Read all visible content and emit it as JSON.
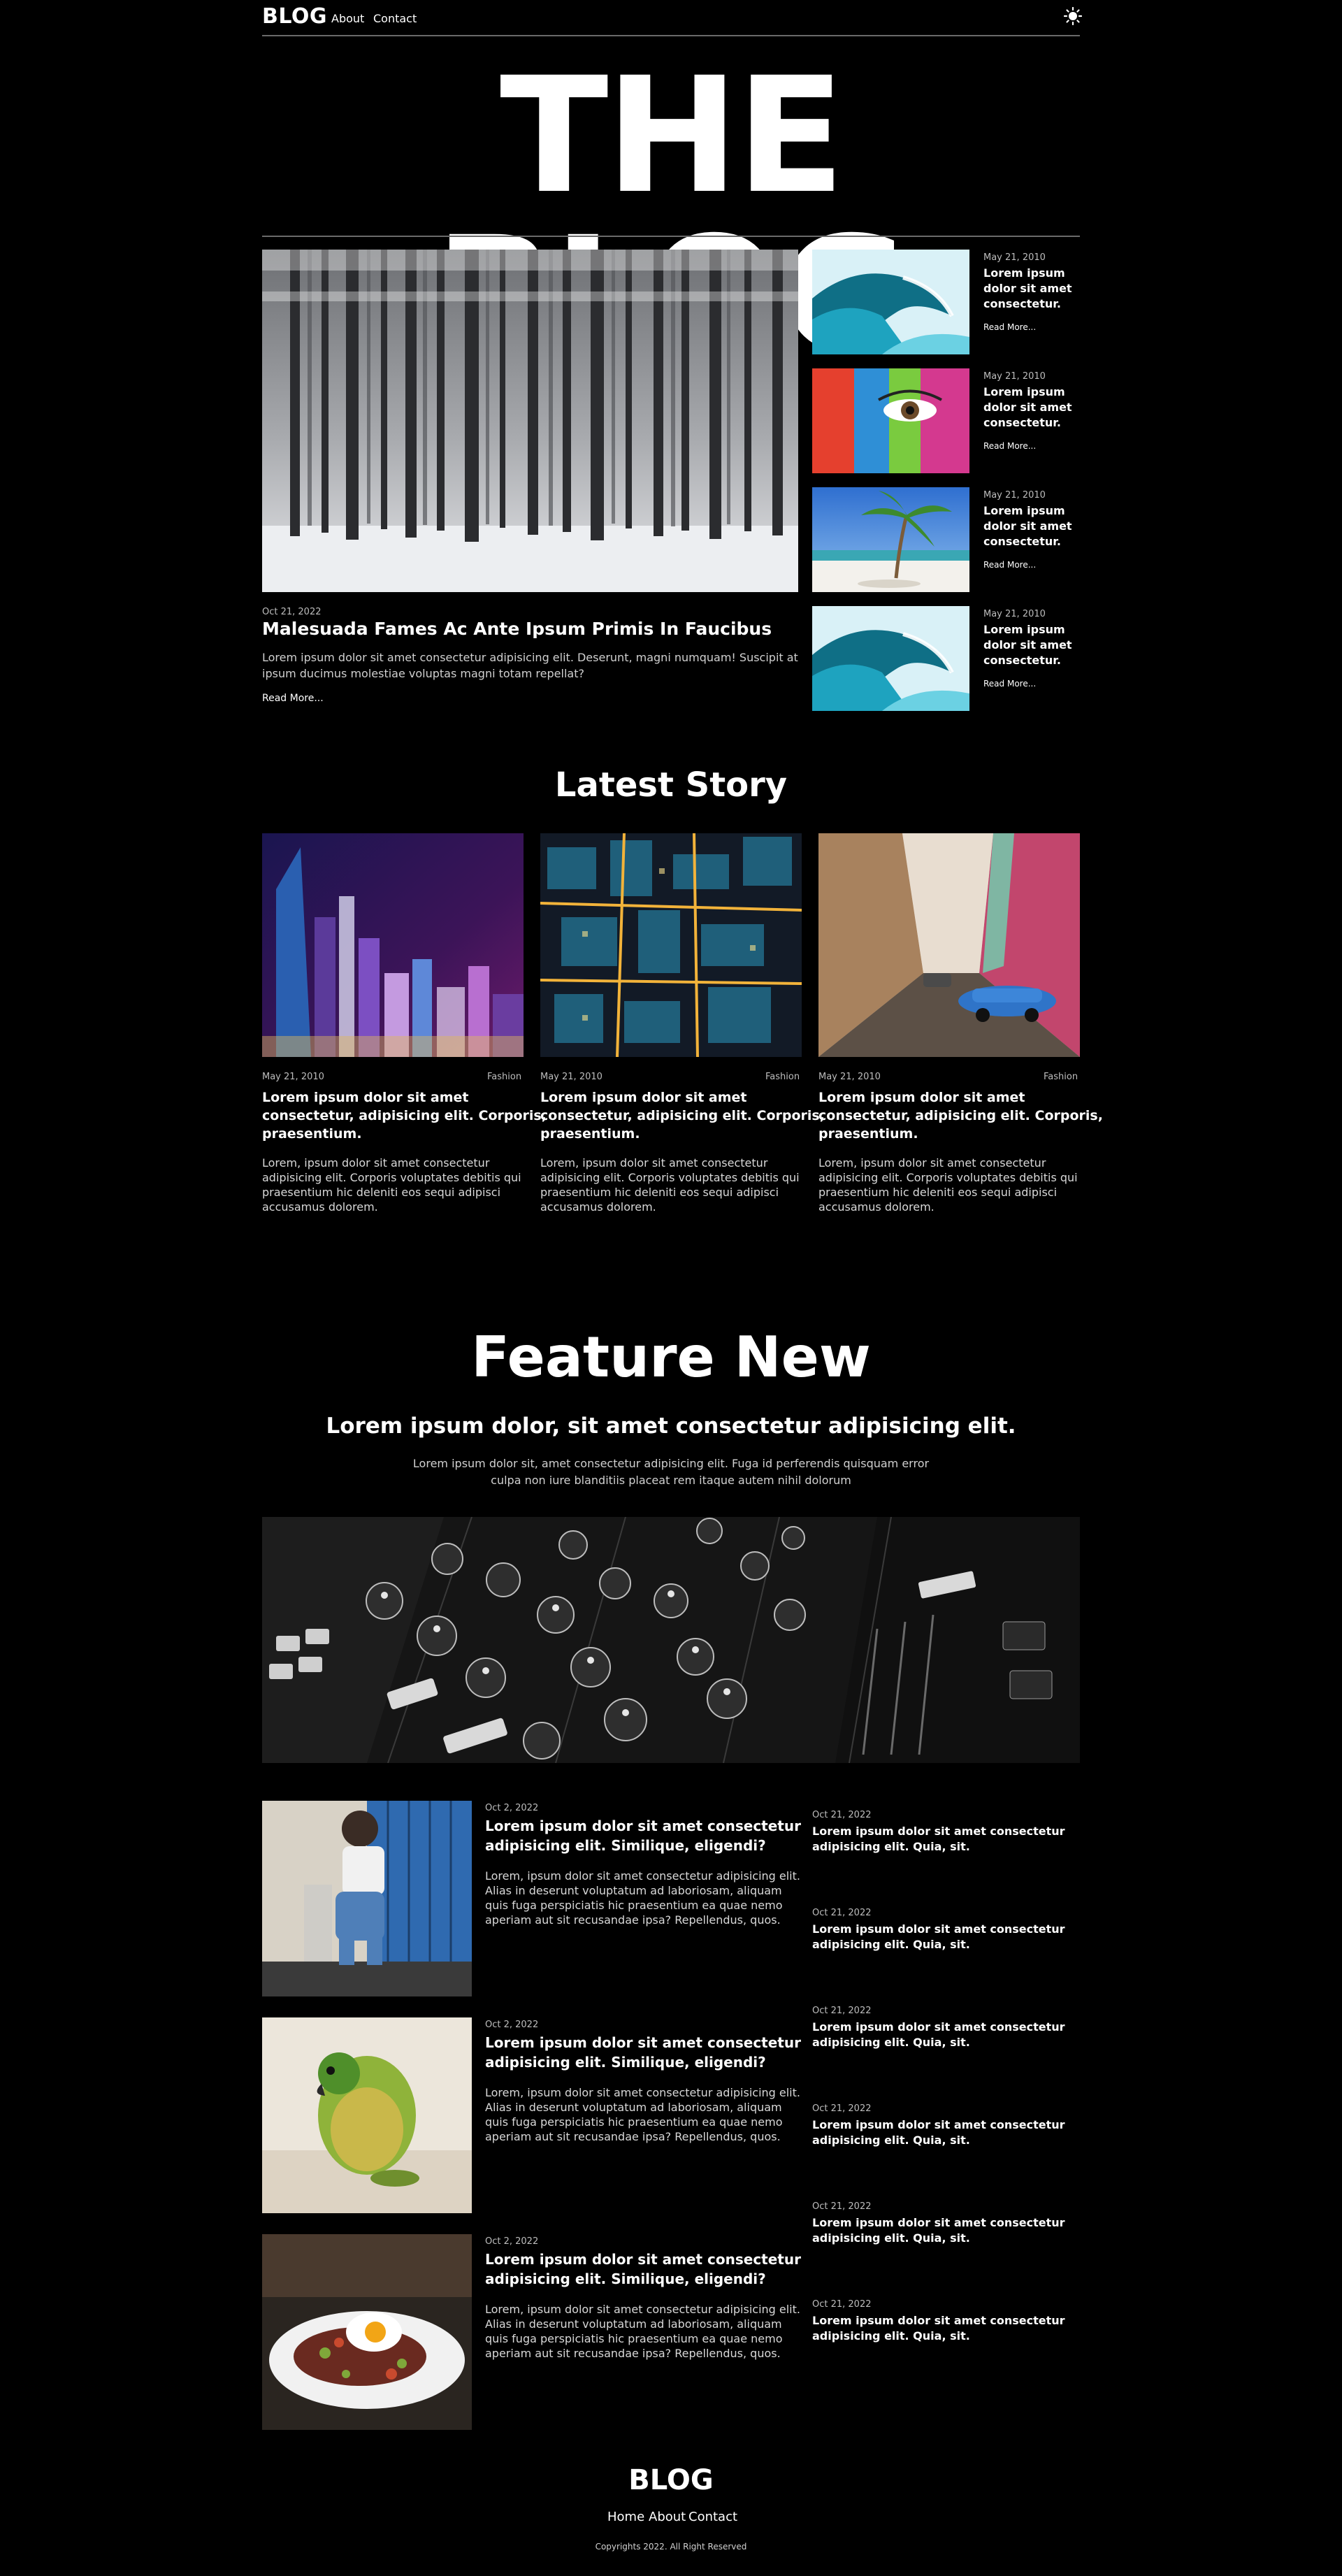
{
  "nav": {
    "logo": "BLOG",
    "links": [
      "About",
      "Contact"
    ],
    "theme_icon": "sun-icon"
  },
  "hero": {
    "title": "THE BLOG"
  },
  "top_story": {
    "date": "Oct 21, 2022",
    "title": "Malesuada Fames Ac Ante Ipsum Primis In Faucibus",
    "excerpt_line1": "Lorem ipsum dolor sit amet consectetur adipisicing elit. Deserunt, magni numquam! Suscipit at",
    "excerpt_line2": "ipsum ducimus molestiae voluptas magni totam repellat?",
    "read_more": "Read More..."
  },
  "side_posts": [
    {
      "date": "May 21, 2010",
      "title_l1": "Lorem ipsum",
      "title_l2": "dolor sit amet",
      "title_l3": "consectetur.",
      "read_more": "Read More...",
      "image": "wave"
    },
    {
      "date": "May 21, 2010",
      "title_l1": "Lorem ipsum",
      "title_l2": "dolor sit amet",
      "title_l3": "consectetur.",
      "read_more": "Read More...",
      "image": "painted-face"
    },
    {
      "date": "May 21, 2010",
      "title_l1": "Lorem ipsum",
      "title_l2": "dolor sit amet",
      "title_l3": "consectetur.",
      "read_more": "Read More...",
      "image": "beach-palm"
    },
    {
      "date": "May 21, 2010",
      "title_l1": "Lorem ipsum",
      "title_l2": "dolor sit amet",
      "title_l3": "consectetur.",
      "read_more": "Read More...",
      "image": "wave"
    }
  ],
  "latest": {
    "heading": "Latest Story",
    "cards": [
      {
        "date": "May 21, 2010",
        "tag": "Fashion",
        "title_l1": "Lorem ipsum dolor sit amet",
        "title_l2": "consectetur, adipisicing elit. Corporis,",
        "title_l3": "praesentium.",
        "ex_l1": "Lorem, ipsum dolor sit amet consectetur",
        "ex_l2": "adipisicing elit. Corporis voluptates debitis qui",
        "ex_l3": "praesentium hic deleniti eos sequi adipisci",
        "ex_l4": "accusamus dolorem."
      },
      {
        "date": "May 21, 2010",
        "tag": "Fashion",
        "title_l1": "Lorem ipsum dolor sit amet",
        "title_l2": "consectetur, adipisicing elit. Corporis,",
        "title_l3": "praesentium.",
        "ex_l1": "Lorem, ipsum dolor sit amet consectetur",
        "ex_l2": "adipisicing elit. Corporis voluptates debitis qui",
        "ex_l3": "praesentium hic deleniti eos sequi adipisci",
        "ex_l4": "accusamus dolorem."
      },
      {
        "date": "May 21, 2010",
        "tag": "Fashion",
        "title_l1": "Lorem ipsum dolor sit amet",
        "title_l2": "consectetur, adipisicing elit. Corporis,",
        "title_l3": "praesentium.",
        "ex_l1": "Lorem, ipsum dolor sit amet consectetur",
        "ex_l2": "adipisicing elit. Corporis voluptates debitis qui",
        "ex_l3": "praesentium hic deleniti eos sequi adipisci",
        "ex_l4": "accusamus dolorem."
      }
    ]
  },
  "feature": {
    "heading": "Feature New",
    "subheading": "Lorem ipsum dolor, sit amet consectetur adipisicing elit.",
    "desc_l1": "Lorem ipsum dolor sit, amet consectetur adipisicing elit. Fuga id perferendis quisquam error",
    "desc_l2": "culpa non iure blanditiis placeat rem itaque autem nihil dolorum"
  },
  "posts": [
    {
      "date": "Oct 2, 2022",
      "title_l1": "Lorem ipsum dolor sit amet consectetur",
      "title_l2": "adipisicing elit. Similique, eligendi?",
      "ex_l1": "Lorem, ipsum dolor sit amet consectetur adipisicing elit.",
      "ex_l2": "Alias in deserunt voluptatum ad laboriosam, aliquam",
      "ex_l3": "quis fuga perspiciatis hic praesentium ea quae nemo",
      "ex_l4": "aperiam aut sit recusandae ipsa? Repellendus, quos."
    },
    {
      "date": "Oct 2, 2022",
      "title_l1": "Lorem ipsum dolor sit amet consectetur",
      "title_l2": "adipisicing elit. Similique, eligendi?",
      "ex_l1": "Lorem, ipsum dolor sit amet consectetur adipisicing elit.",
      "ex_l2": "Alias in deserunt voluptatum ad laboriosam, aliquam",
      "ex_l3": "quis fuga perspiciatis hic praesentium ea quae nemo",
      "ex_l4": "aperiam aut sit recusandae ipsa? Repellendus, quos."
    },
    {
      "date": "Oct 2, 2022",
      "title_l1": "Lorem ipsum dolor sit amet consectetur",
      "title_l2": "adipisicing elit. Similique, eligendi?",
      "ex_l1": "Lorem, ipsum dolor sit amet consectetur adipisicing elit.",
      "ex_l2": "Alias in deserunt voluptatum ad laboriosam, aliquam",
      "ex_l3": "quis fuga perspiciatis hic praesentium ea quae nemo",
      "ex_l4": "aperiam aut sit recusandae ipsa? Repellendus, quos."
    }
  ],
  "mini_posts": [
    {
      "date": "Oct 21, 2022",
      "title_l1": "Lorem ipsum dolor sit amet consectetur",
      "title_l2": "adipisicing elit. Quia, sit."
    },
    {
      "date": "Oct 21, 2022",
      "title_l1": "Lorem ipsum dolor sit amet consectetur",
      "title_l2": "adipisicing elit. Quia, sit."
    },
    {
      "date": "Oct 21, 2022",
      "title_l1": "Lorem ipsum dolor sit amet consectetur",
      "title_l2": "adipisicing elit. Quia, sit."
    },
    {
      "date": "Oct 21, 2022",
      "title_l1": "Lorem ipsum dolor sit amet consectetur",
      "title_l2": "adipisicing elit. Quia, sit."
    },
    {
      "date": "Oct 21, 2022",
      "title_l1": "Lorem ipsum dolor sit amet consectetur",
      "title_l2": "adipisicing elit. Quia, sit."
    },
    {
      "date": "Oct 21, 2022",
      "title_l1": "Lorem ipsum dolor sit amet consectetur",
      "title_l2": "adipisicing elit. Quia, sit."
    }
  ],
  "footer": {
    "logo": "BLOG",
    "links": [
      "Home",
      "About",
      "Contact"
    ],
    "copyright": "Copyrights 2022. All Right Reserved"
  }
}
